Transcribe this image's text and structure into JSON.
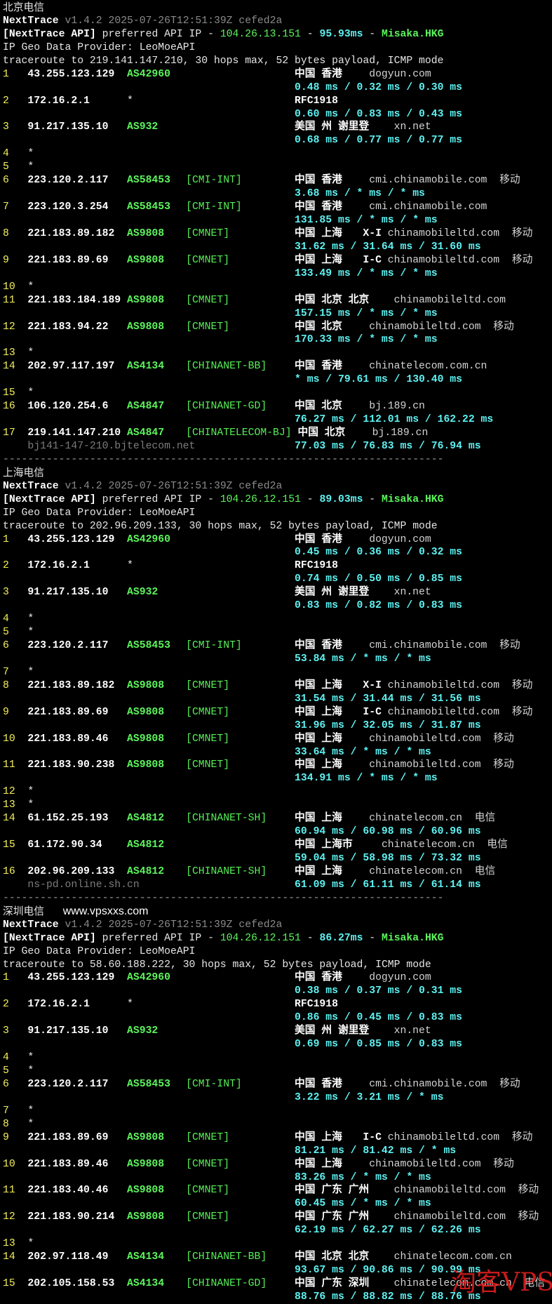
{
  "separator": "-----------------------------------------------------------------------",
  "watermark": "淘客VPS",
  "colors": {
    "hop_number": "#f3ef5a",
    "asn": "#5cf55c",
    "latency": "#5ef2f2",
    "version": "#8a8a8a",
    "watermark": "#eb1e1e"
  },
  "sections": [
    {
      "title": "北京电信",
      "version": {
        "name": "NextTrace",
        "rest": "v1.4.2 2025-07-26T12:51:39Z cefed2a"
      },
      "api": {
        "label": "[NextTrace API]",
        "text": "preferred API IP",
        "sep": " - ",
        "ip": "104.26.13.151",
        "ms": "95.93ms",
        "loc": "Misaka.HKG"
      },
      "provider": "IP Geo Data Provider: LeoMoeAPI",
      "trace": "traceroute to 219.141.147.210, 30 hops max, 52 bytes payload, ICMP mode",
      "hops": [
        {
          "n": "1",
          "ip": "43.255.123.129",
          "asn": "AS42960",
          "geo": "中国 香港",
          "host": "dogyun.com",
          "lat": "0.48 ms / 0.32 ms / 0.30 ms"
        },
        {
          "n": "2",
          "ip": "172.16.2.1",
          "asn": "*",
          "geo": "RFC1918",
          "lat": "0.60 ms / 0.83 ms / 0.43 ms"
        },
        {
          "n": "3",
          "ip": "91.217.135.10",
          "asn": "AS932",
          "geo": "美国 州 谢里登",
          "host": "xn.net",
          "lat": "0.68 ms / 0.77 ms / 0.77 ms"
        },
        {
          "n": "4",
          "ip": "*"
        },
        {
          "n": "5",
          "ip": "*"
        },
        {
          "n": "6",
          "ip": "223.120.2.117",
          "asn": "AS58453",
          "tag": "[CMI-INT]",
          "geo": "中国 香港",
          "host": "cmi.chinamobile.com",
          "isp": "移动",
          "lat": "3.68 ms / * ms / * ms"
        },
        {
          "n": "7",
          "ip": "223.120.3.254",
          "asn": "AS58453",
          "tag": "[CMI-INT]",
          "geo": "中国 香港",
          "host": "cmi.chinamobile.com",
          "lat": "131.85 ms / * ms / * ms"
        },
        {
          "n": "8",
          "ip": "221.183.89.182",
          "asn": "AS9808",
          "tag": "[CMNET]",
          "geo": "中国 上海",
          "node": "X-I",
          "host": "chinamobileltd.com",
          "isp": "移动",
          "lat": "31.62 ms / 31.64 ms / 31.60 ms"
        },
        {
          "n": "9",
          "ip": "221.183.89.69",
          "asn": "AS9808",
          "tag": "[CMNET]",
          "geo": "中国 上海",
          "node": "I-C",
          "host": "chinamobileltd.com",
          "isp": "移动",
          "lat": "133.49 ms / * ms / * ms"
        },
        {
          "n": "10",
          "ip": "*"
        },
        {
          "n": "11",
          "ip": "221.183.184.189",
          "asn": "AS9808",
          "tag": "[CMNET]",
          "geo": "中国 北京 北京",
          "host": "chinamobileltd.com",
          "lat": "157.15 ms / * ms / * ms"
        },
        {
          "n": "12",
          "ip": "221.183.94.22",
          "asn": "AS9808",
          "tag": "[CMNET]",
          "geo": "中国 北京",
          "host": "chinamobileltd.com",
          "isp": "移动",
          "lat": "170.33 ms / * ms / * ms"
        },
        {
          "n": "13",
          "ip": "*"
        },
        {
          "n": "14",
          "ip": "202.97.117.197",
          "asn": "AS4134",
          "tag": "[CHINANET-BB]",
          "geo": "中国 香港",
          "host": "chinatelecom.com.cn",
          "lat": "* ms / 79.61 ms / 130.40 ms"
        },
        {
          "n": "15",
          "ip": "*"
        },
        {
          "n": "16",
          "ip": "106.120.254.6",
          "asn": "AS4847",
          "tag": "[CHINANET-GD]",
          "geo": "中国 北京",
          "host": "bj.189.cn",
          "lat": "76.27 ms / 112.01 ms / 162.22 ms"
        },
        {
          "n": "17",
          "ip": "219.141.147.210",
          "asn": "AS4847",
          "tag": "[CHINATELECOM-BJ]",
          "geo": "中国 北京",
          "host": "bj.189.cn",
          "rdns": "bj141-147-210.bjtelecom.net",
          "lat": "77.03 ms / 76.83 ms / 76.94 ms"
        }
      ]
    },
    {
      "title": "上海电信",
      "version": {
        "name": "NextTrace",
        "rest": "v1.4.2 2025-07-26T12:51:39Z cefed2a"
      },
      "api": {
        "label": "[NextTrace API]",
        "text": "preferred API IP",
        "sep": " - ",
        "ip": "104.26.12.151",
        "ms": "89.03ms",
        "loc": "Misaka.HKG"
      },
      "provider": "IP Geo Data Provider: LeoMoeAPI",
      "trace": "traceroute to 202.96.209.133, 30 hops max, 52 bytes payload, ICMP mode",
      "hops": [
        {
          "n": "1",
          "ip": "43.255.123.129",
          "asn": "AS42960",
          "geo": "中国 香港",
          "host": "dogyun.com",
          "lat": "0.45 ms / 0.36 ms / 0.32 ms"
        },
        {
          "n": "2",
          "ip": "172.16.2.1",
          "asn": "*",
          "geo": "RFC1918",
          "lat": "0.74 ms / 0.50 ms / 0.85 ms"
        },
        {
          "n": "3",
          "ip": "91.217.135.10",
          "asn": "AS932",
          "geo": "美国 州 谢里登",
          "host": "xn.net",
          "lat": "0.83 ms / 0.82 ms / 0.83 ms"
        },
        {
          "n": "4",
          "ip": "*"
        },
        {
          "n": "5",
          "ip": "*"
        },
        {
          "n": "6",
          "ip": "223.120.2.117",
          "asn": "AS58453",
          "tag": "[CMI-INT]",
          "geo": "中国 香港",
          "host": "cmi.chinamobile.com",
          "isp": "移动",
          "lat": "53.84 ms / * ms / * ms"
        },
        {
          "n": "7",
          "ip": "*"
        },
        {
          "n": "8",
          "ip": "221.183.89.182",
          "asn": "AS9808",
          "tag": "[CMNET]",
          "geo": "中国 上海",
          "node": "X-I",
          "host": "chinamobileltd.com",
          "isp": "移动",
          "lat": "31.54 ms / 31.44 ms / 31.56 ms"
        },
        {
          "n": "9",
          "ip": "221.183.89.69",
          "asn": "AS9808",
          "tag": "[CMNET]",
          "geo": "中国 上海",
          "node": "I-C",
          "host": "chinamobileltd.com",
          "isp": "移动",
          "lat": "31.96 ms / 32.05 ms / 31.87 ms"
        },
        {
          "n": "10",
          "ip": "221.183.89.46",
          "asn": "AS9808",
          "tag": "[CMNET]",
          "geo": "中国 上海",
          "host": "chinamobileltd.com",
          "isp": "移动",
          "lat": "33.64 ms / * ms / * ms"
        },
        {
          "n": "11",
          "ip": "221.183.90.238",
          "asn": "AS9808",
          "tag": "[CMNET]",
          "geo": "中国 上海",
          "host": "chinamobileltd.com",
          "isp": "移动",
          "lat": "134.91 ms / * ms / * ms"
        },
        {
          "n": "12",
          "ip": "*"
        },
        {
          "n": "13",
          "ip": "*"
        },
        {
          "n": "14",
          "ip": "61.152.25.193",
          "asn": "AS4812",
          "tag": "[CHINANET-SH]",
          "geo": "中国 上海",
          "host": "chinatelecom.cn",
          "isp": "电信",
          "lat": "60.94 ms / 60.98 ms / 60.96 ms"
        },
        {
          "n": "15",
          "ip": "61.172.90.34",
          "asn": "AS4812",
          "geo": "中国 上海市",
          "host": "chinatelecom.cn",
          "isp": "电信",
          "lat": "59.04 ms / 58.98 ms / 73.32 ms"
        },
        {
          "n": "16",
          "ip": "202.96.209.133",
          "asn": "AS4812",
          "tag": "[CHINANET-SH]",
          "geo": "中国 上海",
          "host": "chinatelecom.cn",
          "isp": "电信",
          "rdns": "ns-pd.online.sh.cn",
          "lat": "61.09 ms / 61.11 ms / 61.14 ms"
        }
      ]
    },
    {
      "title": "深圳电信",
      "site": "www.vpsxxs.com",
      "version": {
        "name": "NextTrace",
        "rest": "v1.4.2 2025-07-26T12:51:39Z cefed2a"
      },
      "api": {
        "label": "[NextTrace API]",
        "text": "preferred API IP",
        "sep": " - ",
        "ip": "104.26.12.151",
        "ms": "86.27ms",
        "loc": "Misaka.HKG"
      },
      "provider": "IP Geo Data Provider: LeoMoeAPI",
      "trace": "traceroute to 58.60.188.222, 30 hops max, 52 bytes payload, ICMP mode",
      "hops": [
        {
          "n": "1",
          "ip": "43.255.123.129",
          "asn": "AS42960",
          "geo": "中国 香港",
          "host": "dogyun.com",
          "lat": "0.38 ms / 0.37 ms / 0.31 ms"
        },
        {
          "n": "2",
          "ip": "172.16.2.1",
          "asn": "*",
          "geo": "RFC1918",
          "lat": "0.86 ms / 0.45 ms / 0.83 ms"
        },
        {
          "n": "3",
          "ip": "91.217.135.10",
          "asn": "AS932",
          "geo": "美国 州 谢里登",
          "host": "xn.net",
          "lat": "0.69 ms / 0.85 ms / 0.83 ms"
        },
        {
          "n": "4",
          "ip": "*"
        },
        {
          "n": "5",
          "ip": "*"
        },
        {
          "n": "6",
          "ip": "223.120.2.117",
          "asn": "AS58453",
          "tag": "[CMI-INT]",
          "geo": "中国 香港",
          "host": "cmi.chinamobile.com",
          "isp": "移动",
          "lat": "3.22 ms / 3.21 ms / * ms"
        },
        {
          "n": "7",
          "ip": "*"
        },
        {
          "n": "8",
          "ip": "*"
        },
        {
          "n": "9",
          "ip": "221.183.89.69",
          "asn": "AS9808",
          "tag": "[CMNET]",
          "geo": "中国 上海",
          "node": "I-C",
          "host": "chinamobileltd.com",
          "isp": "移动",
          "lat": "81.21 ms / 81.42 ms / * ms"
        },
        {
          "n": "10",
          "ip": "221.183.89.46",
          "asn": "AS9808",
          "tag": "[CMNET]",
          "geo": "中国 上海",
          "host": "chinamobileltd.com",
          "isp": "移动",
          "lat": "83.26 ms / * ms / * ms"
        },
        {
          "n": "11",
          "ip": "221.183.40.46",
          "asn": "AS9808",
          "tag": "[CMNET]",
          "geo": "中国 广东 广州",
          "host": "chinamobileltd.com",
          "isp": "移动",
          "lat": "60.45 ms / * ms / * ms"
        },
        {
          "n": "12",
          "ip": "221.183.90.214",
          "asn": "AS9808",
          "tag": "[CMNET]",
          "geo": "中国 广东 广州",
          "host": "chinamobileltd.com",
          "isp": "移动",
          "lat": "62.19 ms / 62.27 ms / 62.26 ms"
        },
        {
          "n": "13",
          "ip": "*"
        },
        {
          "n": "14",
          "ip": "202.97.118.49",
          "asn": "AS4134",
          "tag": "[CHINANET-BB]",
          "geo": "中国 北京 北京",
          "host": "chinatelecom.com.cn",
          "lat": "93.67 ms / 90.86 ms / 90.99 ms"
        },
        {
          "n": "15",
          "ip": "202.105.158.53",
          "asn": "AS4134",
          "tag": "[CHINANET-GD]",
          "geo": "中国 广东 深圳",
          "host": "chinatelecom.com.cn",
          "isp": "电信",
          "lat": "88.76 ms / 88.82 ms / 88.76 ms"
        }
      ]
    }
  ]
}
